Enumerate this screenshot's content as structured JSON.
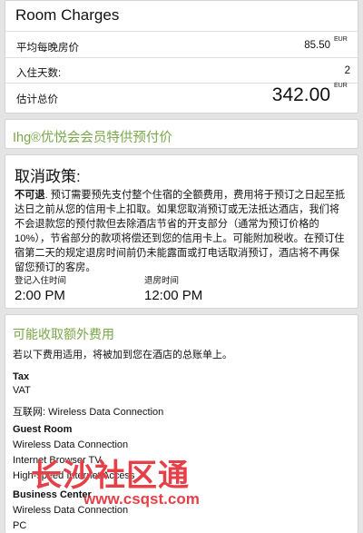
{
  "charges": {
    "title": "Room Charges",
    "avg_label": "平均每晚房价",
    "avg_value": "85.50",
    "avg_currency": "EUR",
    "nights_label": "入住天数:",
    "nights_value": "2",
    "total_label": "估计总价",
    "total_value": "342.00",
    "total_currency": "EUR"
  },
  "ihg": {
    "title": "Ihg®优悦会会员特供预付价"
  },
  "cancel": {
    "heading": "取消政策:",
    "lead": "不可退",
    "text": ". 预订需要预先支付整个住宿的全额费用，费用将于预订之日起至抵达日之前从您的信用卡上扣取。如果您取消预订或无法抵达酒店，我们将不会退款您的预付款但去除酒店节省的开支部分（通常为预订价格的10%），节省部分的款项将偿还到您的信用卡上。可能附加税收。在预订住宿第二天的规定退房时间前仍未能露面或打电话取消预订，酒店将不再保留您预订的客房。",
    "checkin_label": "登记入住时间",
    "checkin_time": "2:00 PM",
    "checkout_label": "退房时间",
    "checkout_time": "12:00 PM"
  },
  "extra": {
    "heading": "可能收取额外费用",
    "intro": "若以下费用适用，将被加到您在酒店的总账单上。",
    "tax_heading": "Tax",
    "tax_item": "VAT",
    "internet_line": "互联网: Wireless Data Connection",
    "guest_heading": "Guest Room",
    "guest_items": [
      "Wireless Data Connection",
      "Internet Browser TV",
      "High-speed Internet Access"
    ],
    "business_heading": "Business Center",
    "business_items": [
      "Wireless Data Connection",
      "PC"
    ]
  },
  "watermark": {
    "line1": "长沙社区通",
    "line2": "www.csqst.com"
  }
}
